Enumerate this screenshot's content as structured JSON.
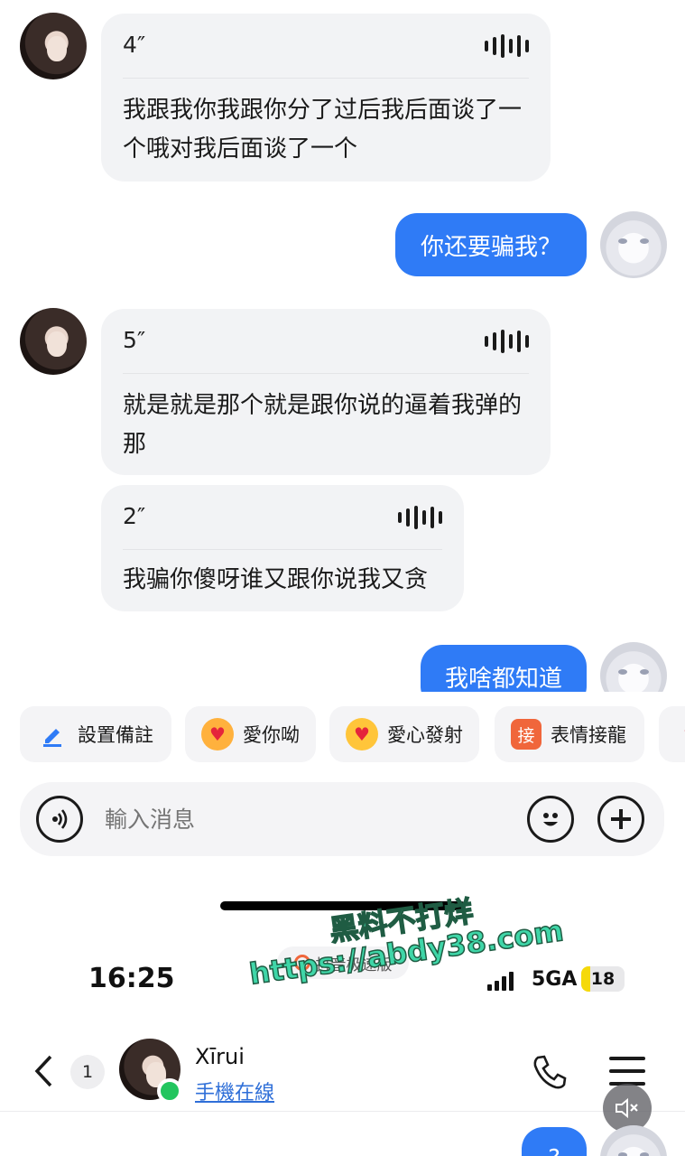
{
  "messages": [
    {
      "duration": "4″",
      "text": "我跟我你我跟你分了过后我后面谈了一个哦对我后面谈了一个"
    },
    {
      "sent": "你还要骗我？"
    },
    {
      "duration": "5″",
      "text": "就是就是那个就是跟你说的逼着我弹的那"
    },
    {
      "duration": "2″",
      "text": "我骗你傻呀谁又跟你说我又贪"
    },
    {
      "sent": "我啥都知道"
    }
  ],
  "quick_actions": [
    {
      "label": "設置備註",
      "icon": "pencil-icon"
    },
    {
      "label": "愛你呦",
      "icon": "heart-eyes-emoji-icon"
    },
    {
      "label": "愛心發射",
      "icon": "hearts-emoji-icon"
    },
    {
      "label": "表情接龍",
      "icon": "jie-badge-icon",
      "badge": "接"
    }
  ],
  "input": {
    "placeholder": "輸入消息"
  },
  "status_bar": {
    "time": "16:25",
    "network": "5GA",
    "battery": "18",
    "pill_text": "抖音极速版"
  },
  "chat_header": {
    "unread": "1",
    "name": "Xīrui",
    "status": "手機在線"
  },
  "last_sent_preview": "?",
  "watermark": {
    "line1": "黑料不打烊",
    "line2": "https://abdy38.com"
  },
  "colors": {
    "accent": "#2f7bf6",
    "online": "#22c55e",
    "battery": "#f5d90a",
    "watermark": "#3fd6a8"
  }
}
